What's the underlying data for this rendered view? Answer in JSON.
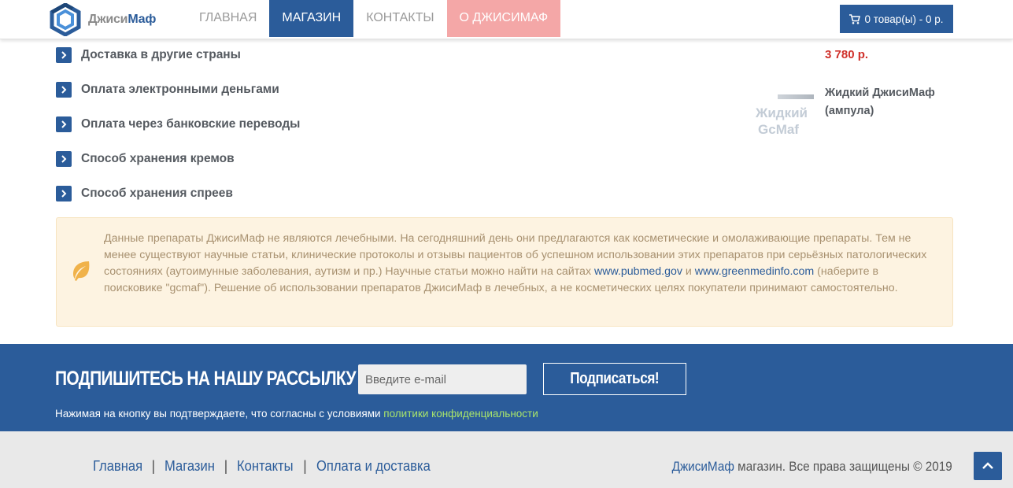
{
  "header": {
    "logo": {
      "text_light": "Джиси",
      "text_dark": "Маф"
    },
    "nav": [
      {
        "label": "ГЛАВНАЯ"
      },
      {
        "label": "МАГАЗИН"
      },
      {
        "label": "КОНТАКТЫ"
      },
      {
        "label": "О ДЖИСИМАФ"
      }
    ],
    "cart": {
      "label": "0 товар(ы) - 0 р."
    }
  },
  "faq": [
    {
      "label": "Доставка в другие страны"
    },
    {
      "label": "Оплата электронными деньгами"
    },
    {
      "label": "Оплата через банковские переводы"
    },
    {
      "label": "Способ хранения кремов"
    },
    {
      "label": "Способ хранения спреев"
    }
  ],
  "products": {
    "price": "3 780 р.",
    "item": {
      "thumb_line1": "Жидкий",
      "thumb_line2": "GcMaf",
      "name": "Жидкий ДжисиМаф (ампула)"
    }
  },
  "notice": {
    "part1": "Данные препараты ДжисиМаф не являются лечебными. На сегодняшний день они предлагаются как косметические и омолаживающие препараты. Тем не менее существуют научные статьи, клинические протоколы и отзывы пациентов об успешном использовании этих препаратов при серьёзных патологических состояниях (аутоимунные заболевания, аутизм и пр.) Научные статьи можно найти на сайтах ",
    "link1": "www.pubmed.gov",
    "part2": " и ",
    "link2": "www.greenmedinfo.com",
    "part3": " (наберите в поисковике \"gcmaf\"). Решение об использовании препаратов ДжисиМаф в лечебных, а не косметических целях покупатели принимают самостоятельно."
  },
  "subscribe": {
    "title": "ПОДПИШИТЕСЬ НА НАШУ РАССЫЛКУ",
    "email_placeholder": "Введите e-mail",
    "button": "Подписаться!",
    "note": "Нажимая на кнопку вы подтверждаете, что согласны с условиями ",
    "note_link": "политики конфиденциальности"
  },
  "footer": {
    "links": [
      {
        "label": "Главная"
      },
      {
        "label": "Магазин"
      },
      {
        "label": "Контакты"
      },
      {
        "label": "Оплата и доставка"
      }
    ],
    "separator": "|",
    "brand": "ДжисиМаф",
    "copyright": " магазин. Все права защищены © 2019"
  },
  "colors": {
    "brand_blue": "#2b5c9a",
    "accent_pink": "#f4a7a7",
    "price_red": "#d0302a",
    "notice_bg": "#fdf3e1",
    "link_green": "#a8e36b"
  },
  "icons": [
    "logo-hexagon-icon",
    "cart-icon",
    "chevron-right-icon",
    "leaf-icon",
    "chevron-up-icon"
  ]
}
